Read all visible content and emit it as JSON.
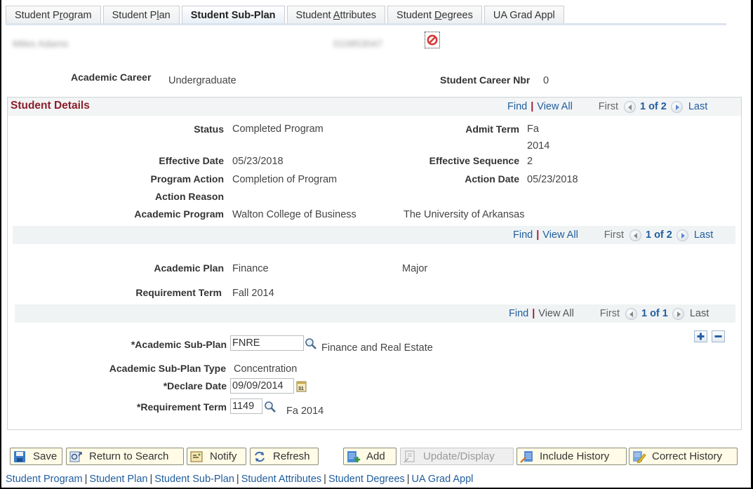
{
  "tabs": [
    {
      "label_pre": "Student P",
      "acc": "r",
      "label_post": "ogram",
      "active": false
    },
    {
      "label_pre": "Student P",
      "acc": "l",
      "label_post": "an",
      "active": false
    },
    {
      "label_pre": "Student Sub-Plan",
      "acc": "",
      "label_post": "",
      "active": true
    },
    {
      "label_pre": "Student ",
      "acc": "A",
      "label_post": "ttributes",
      "active": false
    },
    {
      "label_pre": "Student ",
      "acc": "D",
      "label_post": "egrees",
      "active": false
    },
    {
      "label_pre": "UA Grad Appl",
      "acc": "",
      "label_post": "",
      "active": false
    }
  ],
  "header": {
    "student_name": "Miles Adams",
    "student_id": "010853047",
    "no_icon": "prohibited-icon",
    "academic_career_label": "Academic Career",
    "academic_career_value": "Undergraduate",
    "career_nbr_label": "Student Career Nbr",
    "career_nbr_value": "0"
  },
  "student_details": {
    "title": "Student Details",
    "nav": {
      "find": "Find",
      "view_all": "View All",
      "first": "First",
      "count": "1 of 2",
      "last": "Last"
    },
    "status_label": "Status",
    "status_value": "Completed Program",
    "admit_term_label": "Admit Term",
    "admit_term_value_1": "Fa",
    "admit_term_value_2": "2014",
    "effective_date_label": "Effective Date",
    "effective_date_value": "05/23/2018",
    "effective_seq_label": "Effective Sequence",
    "effective_seq_value": "2",
    "program_action_label": "Program Action",
    "program_action_value": "Completion of Program",
    "action_date_label": "Action Date",
    "action_date_value": "05/23/2018",
    "action_reason_label": "Action Reason",
    "action_reason_value": "",
    "academic_program_label": "Academic Program",
    "academic_program_value": "Walton College of Business",
    "academic_institution_value": "The University of Arkansas"
  },
  "plan": {
    "nav": {
      "find": "Find",
      "view_all": "View All",
      "first": "First",
      "count": "1 of 2",
      "last": "Last"
    },
    "academic_plan_label": "Academic Plan",
    "academic_plan_value": "Finance",
    "plan_type_value": "Major",
    "requirement_term_label": "Requirement Term",
    "requirement_term_value": "Fall 2014"
  },
  "subplan": {
    "nav": {
      "find": "Find",
      "view_all": "View All",
      "first": "First",
      "count": "1 of 1",
      "last": "Last"
    },
    "subplan_label": "*Academic Sub-Plan",
    "subplan_value": "FNRE",
    "subplan_descr": "Finance and Real Estate",
    "subplan_type_label": "Academic Sub-Plan Type",
    "subplan_type_value": "Concentration",
    "declare_date_label": "*Declare Date",
    "declare_date_value": "09/09/2014",
    "req_term_label": "*Requirement Term",
    "req_term_value": "1149",
    "req_term_descr": "Fa 2014"
  },
  "toolbar": {
    "save": "Save",
    "return_to_search": "Return to Search",
    "notify": "Notify",
    "refresh": "Refresh",
    "add": "Add",
    "update_display": "Update/Display",
    "include_history": "Include History",
    "correct_history": "Correct History"
  },
  "footer_links": [
    "Student Program",
    "Student Plan",
    "Student Sub-Plan",
    "Student Attributes",
    "Student Degrees",
    "UA Grad Appl"
  ],
  "colors": {
    "title": "#8a1f2a",
    "link": "#1f5d9e",
    "button_bg": "#fffbe6"
  }
}
